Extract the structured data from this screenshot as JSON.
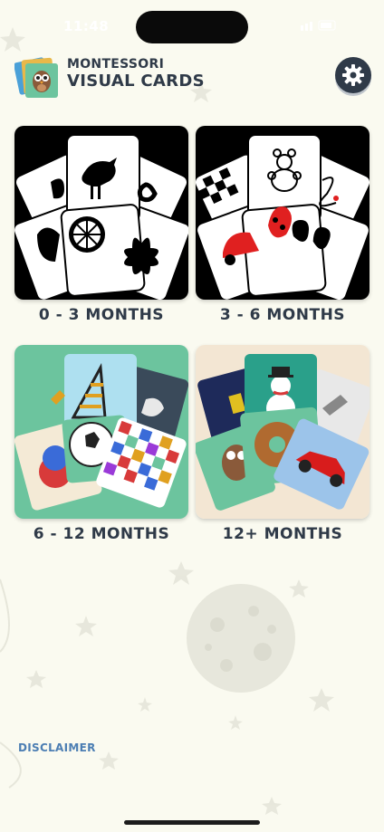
{
  "status_bar": {
    "time": "11:48"
  },
  "app": {
    "title_line1": "MONTESSORI",
    "title_line2": "VISUAL CARDS"
  },
  "icons": {
    "logo": "owl-cards-logo-icon",
    "settings": "gear-icon"
  },
  "categories": [
    {
      "label": "0 - 3 MONTHS",
      "theme": "black-white",
      "bg": "#000000"
    },
    {
      "label": "3 - 6 MONTHS",
      "theme": "black-white-red",
      "bg": "#000000"
    },
    {
      "label": "6 - 12 MONTHS",
      "theme": "color",
      "bg": "#6cc49e"
    },
    {
      "label": "12+ MONTHS",
      "theme": "realistic",
      "bg": "#f3e6d3"
    }
  ],
  "footer": {
    "disclaimer": "DISCLAIMER"
  },
  "colors": {
    "text": "#2f3a48",
    "link": "#4c7eb3",
    "background": "#fafaf0"
  }
}
